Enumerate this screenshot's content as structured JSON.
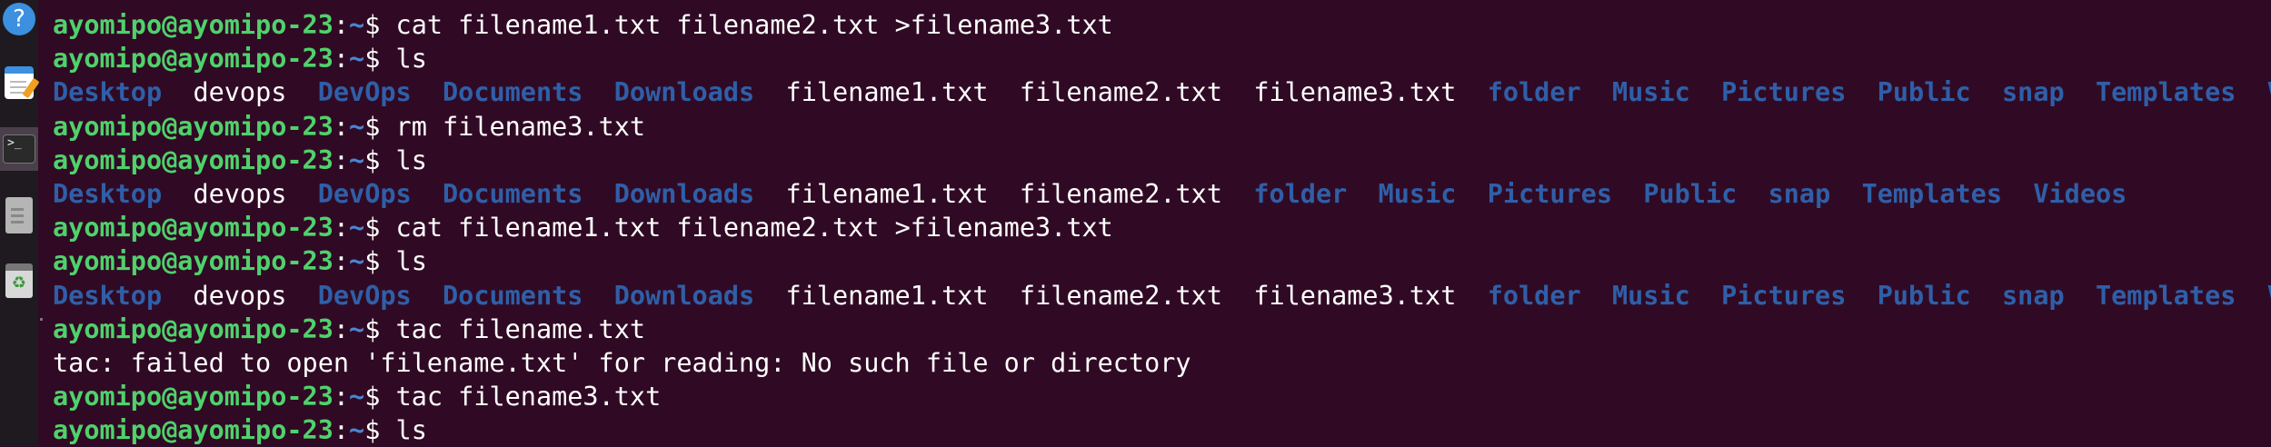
{
  "dock": {
    "items": [
      "help-icon",
      "text-editor-icon",
      "terminal-icon",
      "files-icon",
      "trash-icon"
    ]
  },
  "terminal": {
    "prompt_user": "ayomipo@ayomipo-23",
    "prompt_colon": ":",
    "prompt_path": "~",
    "prompt_dollar": "$ ",
    "lines": [
      {
        "type": "cmd",
        "text": "cat filename1.txt filename2.txt >filename3.txt"
      },
      {
        "type": "cmd",
        "text": "ls"
      },
      {
        "type": "ls",
        "entries": [
          {
            "name": "Desktop",
            "kind": "dir"
          },
          {
            "name": "devops",
            "kind": "file"
          },
          {
            "name": "DevOps",
            "kind": "dir"
          },
          {
            "name": "Documents",
            "kind": "dir"
          },
          {
            "name": "Downloads",
            "kind": "dir"
          },
          {
            "name": "filename1.txt",
            "kind": "file"
          },
          {
            "name": "filename2.txt",
            "kind": "file"
          },
          {
            "name": "filename3.txt",
            "kind": "file"
          },
          {
            "name": "folder",
            "kind": "dir"
          },
          {
            "name": "Music",
            "kind": "dir"
          },
          {
            "name": "Pictures",
            "kind": "dir"
          },
          {
            "name": "Public",
            "kind": "dir"
          },
          {
            "name": "snap",
            "kind": "dir"
          },
          {
            "name": "Templates",
            "kind": "dir"
          },
          {
            "name": "Videos",
            "kind": "dir"
          }
        ]
      },
      {
        "type": "cmd",
        "text": "rm filename3.txt"
      },
      {
        "type": "cmd",
        "text": "ls"
      },
      {
        "type": "ls",
        "entries": [
          {
            "name": "Desktop",
            "kind": "dir"
          },
          {
            "name": "devops",
            "kind": "file"
          },
          {
            "name": "DevOps",
            "kind": "dir"
          },
          {
            "name": "Documents",
            "kind": "dir"
          },
          {
            "name": "Downloads",
            "kind": "dir"
          },
          {
            "name": "filename1.txt",
            "kind": "file"
          },
          {
            "name": "filename2.txt",
            "kind": "file"
          },
          {
            "name": "folder",
            "kind": "dir"
          },
          {
            "name": "Music",
            "kind": "dir"
          },
          {
            "name": "Pictures",
            "kind": "dir"
          },
          {
            "name": "Public",
            "kind": "dir"
          },
          {
            "name": "snap",
            "kind": "dir"
          },
          {
            "name": "Templates",
            "kind": "dir"
          },
          {
            "name": "Videos",
            "kind": "dir"
          }
        ]
      },
      {
        "type": "cmd",
        "text": "cat filename1.txt filename2.txt >filename3.txt"
      },
      {
        "type": "cmd",
        "text": "ls"
      },
      {
        "type": "ls",
        "entries": [
          {
            "name": "Desktop",
            "kind": "dir"
          },
          {
            "name": "devops",
            "kind": "file"
          },
          {
            "name": "DevOps",
            "kind": "dir"
          },
          {
            "name": "Documents",
            "kind": "dir"
          },
          {
            "name": "Downloads",
            "kind": "dir"
          },
          {
            "name": "filename1.txt",
            "kind": "file"
          },
          {
            "name": "filename2.txt",
            "kind": "file"
          },
          {
            "name": "filename3.txt",
            "kind": "file"
          },
          {
            "name": "folder",
            "kind": "dir"
          },
          {
            "name": "Music",
            "kind": "dir"
          },
          {
            "name": "Pictures",
            "kind": "dir"
          },
          {
            "name": "Public",
            "kind": "dir"
          },
          {
            "name": "snap",
            "kind": "dir"
          },
          {
            "name": "Templates",
            "kind": "dir"
          },
          {
            "name": "Videos",
            "kind": "dir"
          }
        ]
      },
      {
        "type": "cmd",
        "text": "tac filename.txt"
      },
      {
        "type": "out",
        "text": "tac: failed to open 'filename.txt' for reading: No such file or directory"
      },
      {
        "type": "cmd",
        "text": "tac filename3.txt"
      },
      {
        "type": "cmd",
        "text": "ls"
      }
    ]
  },
  "colors": {
    "background": "#300a24",
    "prompt_user": "#4fd26b",
    "prompt_path": "#4a86d4",
    "directory": "#2f5fa8",
    "text": "#ffffff"
  }
}
